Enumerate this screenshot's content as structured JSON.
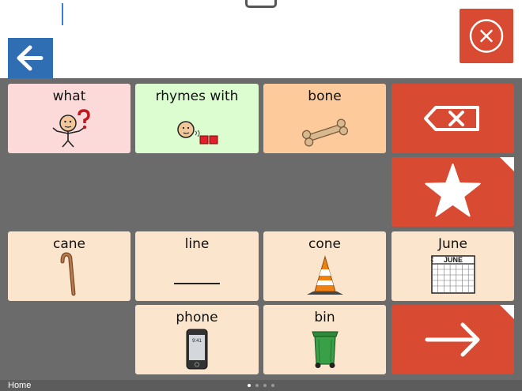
{
  "grid": {
    "cells": [
      {
        "label": "what",
        "color": "#fddada"
      },
      {
        "label": "rhymes with",
        "color": "#dcfdd0"
      },
      {
        "label": "bone",
        "color": "#fdcb9b"
      },
      {
        "label": "cane",
        "color": "#fbe5cc"
      },
      {
        "label": "line",
        "color": "#fbe5cc"
      },
      {
        "label": "cone",
        "color": "#fbe5cc"
      },
      {
        "label": "June",
        "color": "#fbe5cc"
      },
      {
        "label": "phone",
        "color": "#fbe5cc"
      },
      {
        "label": "bin",
        "color": "#fbe5cc"
      }
    ],
    "calendar_month": "JUNE",
    "phone_time": "9:41"
  },
  "footer": {
    "label": "Home"
  },
  "colors": {
    "action_red": "#d94a32",
    "back_blue": "#2f6eb3",
    "grid_bg": "#6b6b6b"
  },
  "icons": [
    "back-arrow-icon",
    "close-circle-icon",
    "backspace-icon",
    "star-icon",
    "next-arrow-icon"
  ]
}
